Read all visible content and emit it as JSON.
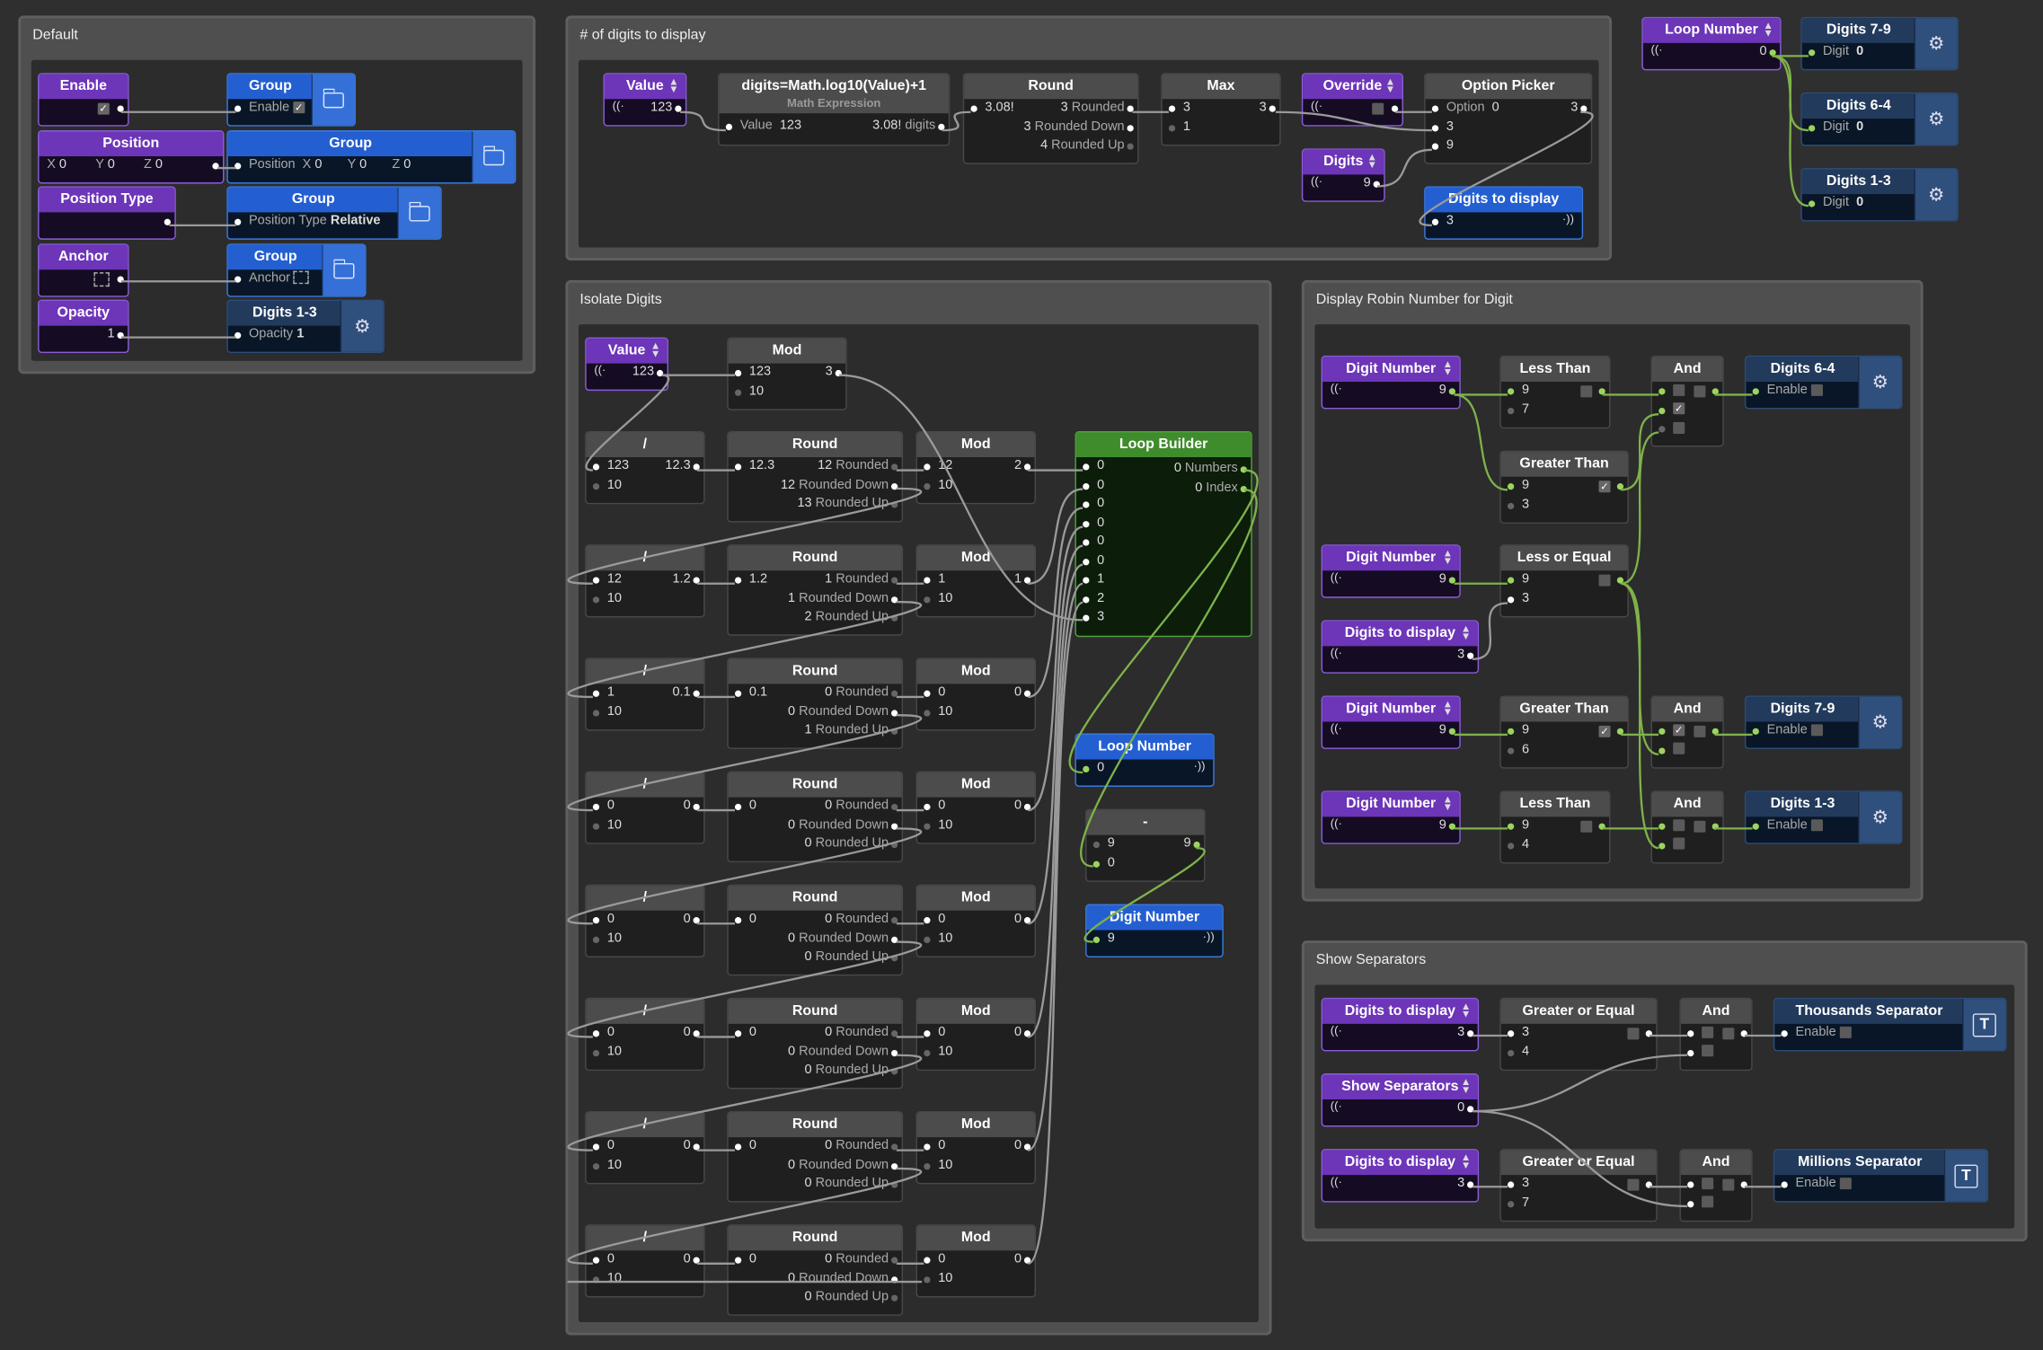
{
  "groups": {
    "default": "Default",
    "digits_count": "# of digits to display",
    "isolate": "Isolate Digits",
    "robin": "Display Robin Number for Digit",
    "separators": "Show Separators"
  },
  "default": {
    "enable": {
      "title": "Enable"
    },
    "group1": {
      "title": "Group",
      "label": "Enable"
    },
    "position": {
      "title": "Position",
      "x": "X",
      "xv": "0",
      "y": "Y",
      "yv": "0",
      "z": "Z",
      "zv": "0"
    },
    "group2": {
      "title": "Group",
      "label": "Position",
      "x": "X",
      "xv": "0",
      "y": "Y",
      "yv": "0",
      "z": "Z",
      "zv": "0"
    },
    "ptype": {
      "title": "Position Type"
    },
    "group3": {
      "title": "Group",
      "label": "Position Type",
      "value": "Relative"
    },
    "anchor": {
      "title": "Anchor"
    },
    "group4": {
      "title": "Group",
      "label": "Anchor"
    },
    "opacity": {
      "title": "Opacity",
      "value": "1"
    },
    "digits13": {
      "title": "Digits 1-3",
      "label": "Opacity",
      "value": "1"
    }
  },
  "count": {
    "value": {
      "title": "Value",
      "v": "123"
    },
    "math": {
      "title": "digits=Math.log10(Value)+1",
      "sub": "Math Expression",
      "in_l": "Value",
      "in_v": "123",
      "out_v": "3.08!",
      "out_l": "digits"
    },
    "round": {
      "title": "Round",
      "in": "3.08!",
      "r1v": "3",
      "r1l": "Rounded",
      "r2v": "3",
      "r2l": "Rounded Down",
      "r3v": "4",
      "r3l": "Rounded Up"
    },
    "max": {
      "title": "Max",
      "a": "3",
      "out": "3",
      "b": "1"
    },
    "override": {
      "title": "Override"
    },
    "digits": {
      "title": "Digits",
      "v": "9"
    },
    "picker": {
      "title": "Option Picker",
      "l": "Option",
      "v": "0",
      "out": "3",
      "a": "3",
      "b": "9"
    },
    "dtd": {
      "title": "Digits to display",
      "v": "3"
    }
  },
  "loop": {
    "num": {
      "title": "Loop Number",
      "v": "0"
    },
    "d79": {
      "title": "Digits 7-9",
      "l": "Digit",
      "v": "0"
    },
    "d64": {
      "title": "Digits 6-4",
      "l": "Digit",
      "v": "0"
    },
    "d13": {
      "title": "Digits 1-3",
      "l": "Digit",
      "v": "0"
    }
  },
  "iso": {
    "value": {
      "title": "Value",
      "v": "123"
    },
    "mod0": {
      "title": "Mod",
      "a": "123",
      "out": "3",
      "b": "10"
    },
    "div": "/",
    "round": "Round",
    "mod": "Mod",
    "lab_rounded": "Rounded",
    "lab_down": "Rounded Down",
    "lab_up": "Rounded Up",
    "rows": [
      {
        "da": "123",
        "dout": "12.3",
        "db": "10",
        "rin": "12.3",
        "r1": "12",
        "r2": "12",
        "r3": "13",
        "ma": "12",
        "mout": "2",
        "mb": "10"
      },
      {
        "da": "12",
        "dout": "1.2",
        "db": "10",
        "rin": "1.2",
        "r1": "1",
        "r2": "1",
        "r3": "2",
        "ma": "1",
        "mout": "1",
        "mb": "10"
      },
      {
        "da": "1",
        "dout": "0.1",
        "db": "10",
        "rin": "0.1",
        "r1": "0",
        "r2": "0",
        "r3": "1",
        "ma": "0",
        "mout": "0",
        "mb": "10"
      },
      {
        "da": "0",
        "dout": "0",
        "db": "10",
        "rin": "0",
        "r1": "0",
        "r2": "0",
        "r3": "0",
        "ma": "0",
        "mout": "0",
        "mb": "10"
      },
      {
        "da": "0",
        "dout": "0",
        "db": "10",
        "rin": "0",
        "r1": "0",
        "r2": "0",
        "r3": "0",
        "ma": "0",
        "mout": "0",
        "mb": "10"
      },
      {
        "da": "0",
        "dout": "0",
        "db": "10",
        "rin": "0",
        "r1": "0",
        "r2": "0",
        "r3": "0",
        "ma": "0",
        "mout": "0",
        "mb": "10"
      },
      {
        "da": "0",
        "dout": "0",
        "db": "10",
        "rin": "0",
        "r1": "0",
        "r2": "0",
        "r3": "0",
        "ma": "0",
        "mout": "0",
        "mb": "10"
      },
      {
        "da": "0",
        "dout": "0",
        "db": "10",
        "rin": "0",
        "r1": "0",
        "r2": "0",
        "r3": "0",
        "ma": "0",
        "mout": "0",
        "mb": "10"
      }
    ],
    "lb": {
      "title": "Loop Builder",
      "items": [
        "0",
        "0",
        "0",
        "0",
        "0",
        "0",
        "1",
        "2",
        "3"
      ],
      "o1v": "0",
      "o1l": "Numbers",
      "o2v": "0",
      "o2l": "Index"
    },
    "lnum": {
      "title": "Loop Number",
      "v": "0"
    },
    "minus": {
      "title": "-",
      "a": "9",
      "out": "9",
      "b": "0"
    },
    "dnum": {
      "title": "Digit Number",
      "v": "9"
    }
  },
  "robin": {
    "dn1": {
      "title": "Digit Number",
      "v": "9"
    },
    "lt1": {
      "title": "Less Than",
      "a": "9",
      "b": "7"
    },
    "gt1": {
      "title": "Greater Than",
      "a": "9",
      "b": "3"
    },
    "and1": {
      "title": "And"
    },
    "d64": {
      "title": "Digits 6-4",
      "l": "Enable"
    },
    "dn2": {
      "title": "Digit Number",
      "v": "9"
    },
    "le": {
      "title": "Less or Equal",
      "a": "9",
      "b": "3"
    },
    "dtd": {
      "title": "Digits to display",
      "v": "3"
    },
    "dn3": {
      "title": "Digit Number",
      "v": "9"
    },
    "gt2": {
      "title": "Greater Than",
      "a": "9",
      "b": "6"
    },
    "and2": {
      "title": "And"
    },
    "d79": {
      "title": "Digits 7-9",
      "l": "Enable"
    },
    "dn4": {
      "title": "Digit Number",
      "v": "9"
    },
    "lt2": {
      "title": "Less Than",
      "a": "9",
      "b": "4"
    },
    "and3": {
      "title": "And"
    },
    "d13": {
      "title": "Digits 1-3",
      "l": "Enable"
    }
  },
  "sep": {
    "dtd1": {
      "title": "Digits to display",
      "v": "3"
    },
    "ge1": {
      "title": "Greater or Equal",
      "a": "3",
      "b": "4"
    },
    "and1": {
      "title": "And"
    },
    "ts": {
      "title": "Thousands Separator",
      "l": "Enable"
    },
    "show": {
      "title": "Show Separators",
      "v": "0"
    },
    "dtd2": {
      "title": "Digits to display",
      "v": "3"
    },
    "ge2": {
      "title": "Greater or Equal",
      "a": "3",
      "b": "7"
    },
    "and2": {
      "title": "And"
    },
    "ms": {
      "title": "Millions Separator",
      "l": "Enable"
    }
  },
  "colors": {
    "canvas": "#2f2f2f",
    "purple": "#6d35b8",
    "blue": "#245fd1",
    "green": "#3f8c2c",
    "layer": "#223a5c",
    "wire": "#9a9a9a",
    "wire_active": "#7fb24a"
  },
  "icons": {
    "folder": "folder-icon",
    "gear": "gear-icon",
    "text": "text-layer-icon",
    "broadcast": "broadcast-icon",
    "stepper": "stepper-arrows-icon"
  }
}
